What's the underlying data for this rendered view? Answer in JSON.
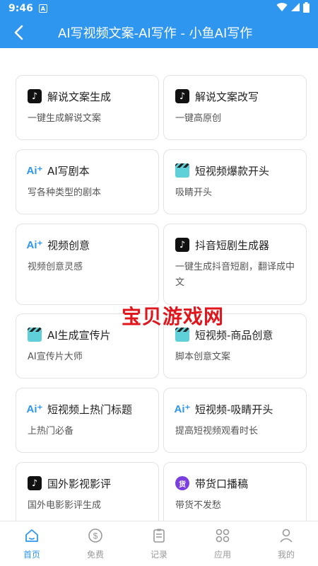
{
  "status_bar": {
    "time": "9:46",
    "sim_label": "A"
  },
  "app_bar": {
    "title": "AI写视频文案-AI写作 - 小鱼AI写作"
  },
  "cards": [
    {
      "icon": "tiktok-icon",
      "name": "解说文案生成",
      "desc": "一键生成解说文案"
    },
    {
      "icon": "tiktok-icon",
      "name": "解说文案改写",
      "desc": "一键高原创"
    },
    {
      "icon": "ai-icon",
      "name": "AI写剧本",
      "desc": "写各种类型的剧本"
    },
    {
      "icon": "clapper-icon",
      "name": "短视频爆款开头",
      "desc": "吸睛开头"
    },
    {
      "icon": "ai-icon",
      "name": "视频创意",
      "desc": "视频创意灵感"
    },
    {
      "icon": "tiktok-icon",
      "name": "抖音短剧生成器",
      "desc": "一键生成抖音短剧，翻译成中文"
    },
    {
      "icon": "clapper-icon",
      "name": "AI生成宣传片",
      "desc": "AI宣传片大师"
    },
    {
      "icon": "clapper-icon",
      "name": "短视频-商品创意",
      "desc": "脚本创意文案"
    },
    {
      "icon": "ai-icon",
      "name": "短视频上热门标题",
      "desc": "上热门必备"
    },
    {
      "icon": "ai-icon",
      "name": "短视频-吸睛开头",
      "desc": "提高短视频观看时长"
    },
    {
      "icon": "tiktok-icon",
      "name": "国外影视影评",
      "desc": "国外电影影评生成"
    },
    {
      "icon": "goods-icon",
      "name": "带货口播稿",
      "desc": "带货不发愁",
      "icon_text": "货"
    }
  ],
  "watermark": "宝贝游戏网",
  "tabs": [
    {
      "label": "首页",
      "icon": "home-icon",
      "active": true
    },
    {
      "label": "免费",
      "icon": "dollar-icon",
      "active": false
    },
    {
      "label": "记录",
      "icon": "clipboard-icon",
      "active": false
    },
    {
      "label": "应用",
      "icon": "apps-icon",
      "active": false
    },
    {
      "label": "我的",
      "icon": "user-icon",
      "active": false
    }
  ],
  "colors": {
    "primary": "#2e96ee",
    "tab_inactive": "#999999",
    "watermark": "#e0161d"
  }
}
